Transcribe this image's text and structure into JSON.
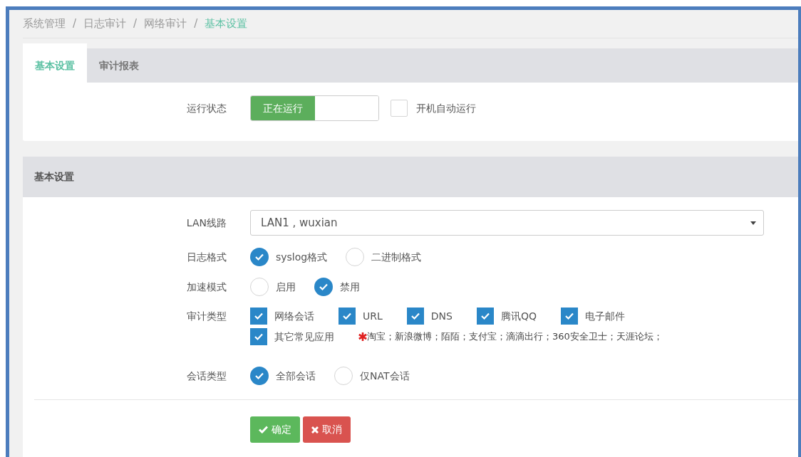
{
  "breadcrumb_separator": "/",
  "breadcrumb": [
    {
      "label": "系统管理",
      "current": false
    },
    {
      "label": "日志审计",
      "current": false
    },
    {
      "label": "网络审计",
      "current": false
    },
    {
      "label": "基本设置",
      "current": true
    }
  ],
  "tabs": [
    {
      "label": "基本设置",
      "selected": true
    },
    {
      "label": "审计报表",
      "selected": false
    }
  ],
  "run_status": {
    "label": "运行状态",
    "state_text": "正在运行",
    "on": true,
    "autostart": {
      "label": "开机自动运行",
      "checked": false
    }
  },
  "panel": {
    "title": "基本设置",
    "fields": [
      {
        "kind": "select",
        "label": "LAN线路",
        "value": "LAN1 , wuxian"
      },
      {
        "kind": "radio",
        "label": "日志格式",
        "options": [
          {
            "label": "syslog格式",
            "selected": true
          },
          {
            "label": "二进制格式",
            "selected": false
          }
        ]
      },
      {
        "kind": "radio",
        "label": "加速模式",
        "options": [
          {
            "label": "启用",
            "selected": false
          },
          {
            "label": "禁用",
            "selected": true
          }
        ]
      },
      {
        "kind": "checkbox",
        "label": "审计类型",
        "option_rows": [
          [
            {
              "label": "网络会话",
              "checked": true
            },
            {
              "label": "URL",
              "checked": true
            },
            {
              "label": "DNS",
              "checked": true
            },
            {
              "label": "腾讯QQ",
              "checked": true
            },
            {
              "label": "电子邮件",
              "checked": true
            }
          ],
          [
            {
              "label": "其它常见应用",
              "checked": true
            }
          ]
        ],
        "note": "淘宝；新浪微博；陌陌；支付宝；滴滴出行；360安全卫士；天涯论坛；"
      },
      {
        "kind": "radio",
        "label": "会话类型",
        "options": [
          {
            "label": "全部会话",
            "selected": true
          },
          {
            "label": "仅NAT会话",
            "selected": false
          }
        ]
      }
    ]
  },
  "buttons": [
    {
      "kind": "confirm",
      "label": "确定"
    },
    {
      "kind": "cancel",
      "label": "取消"
    }
  ]
}
